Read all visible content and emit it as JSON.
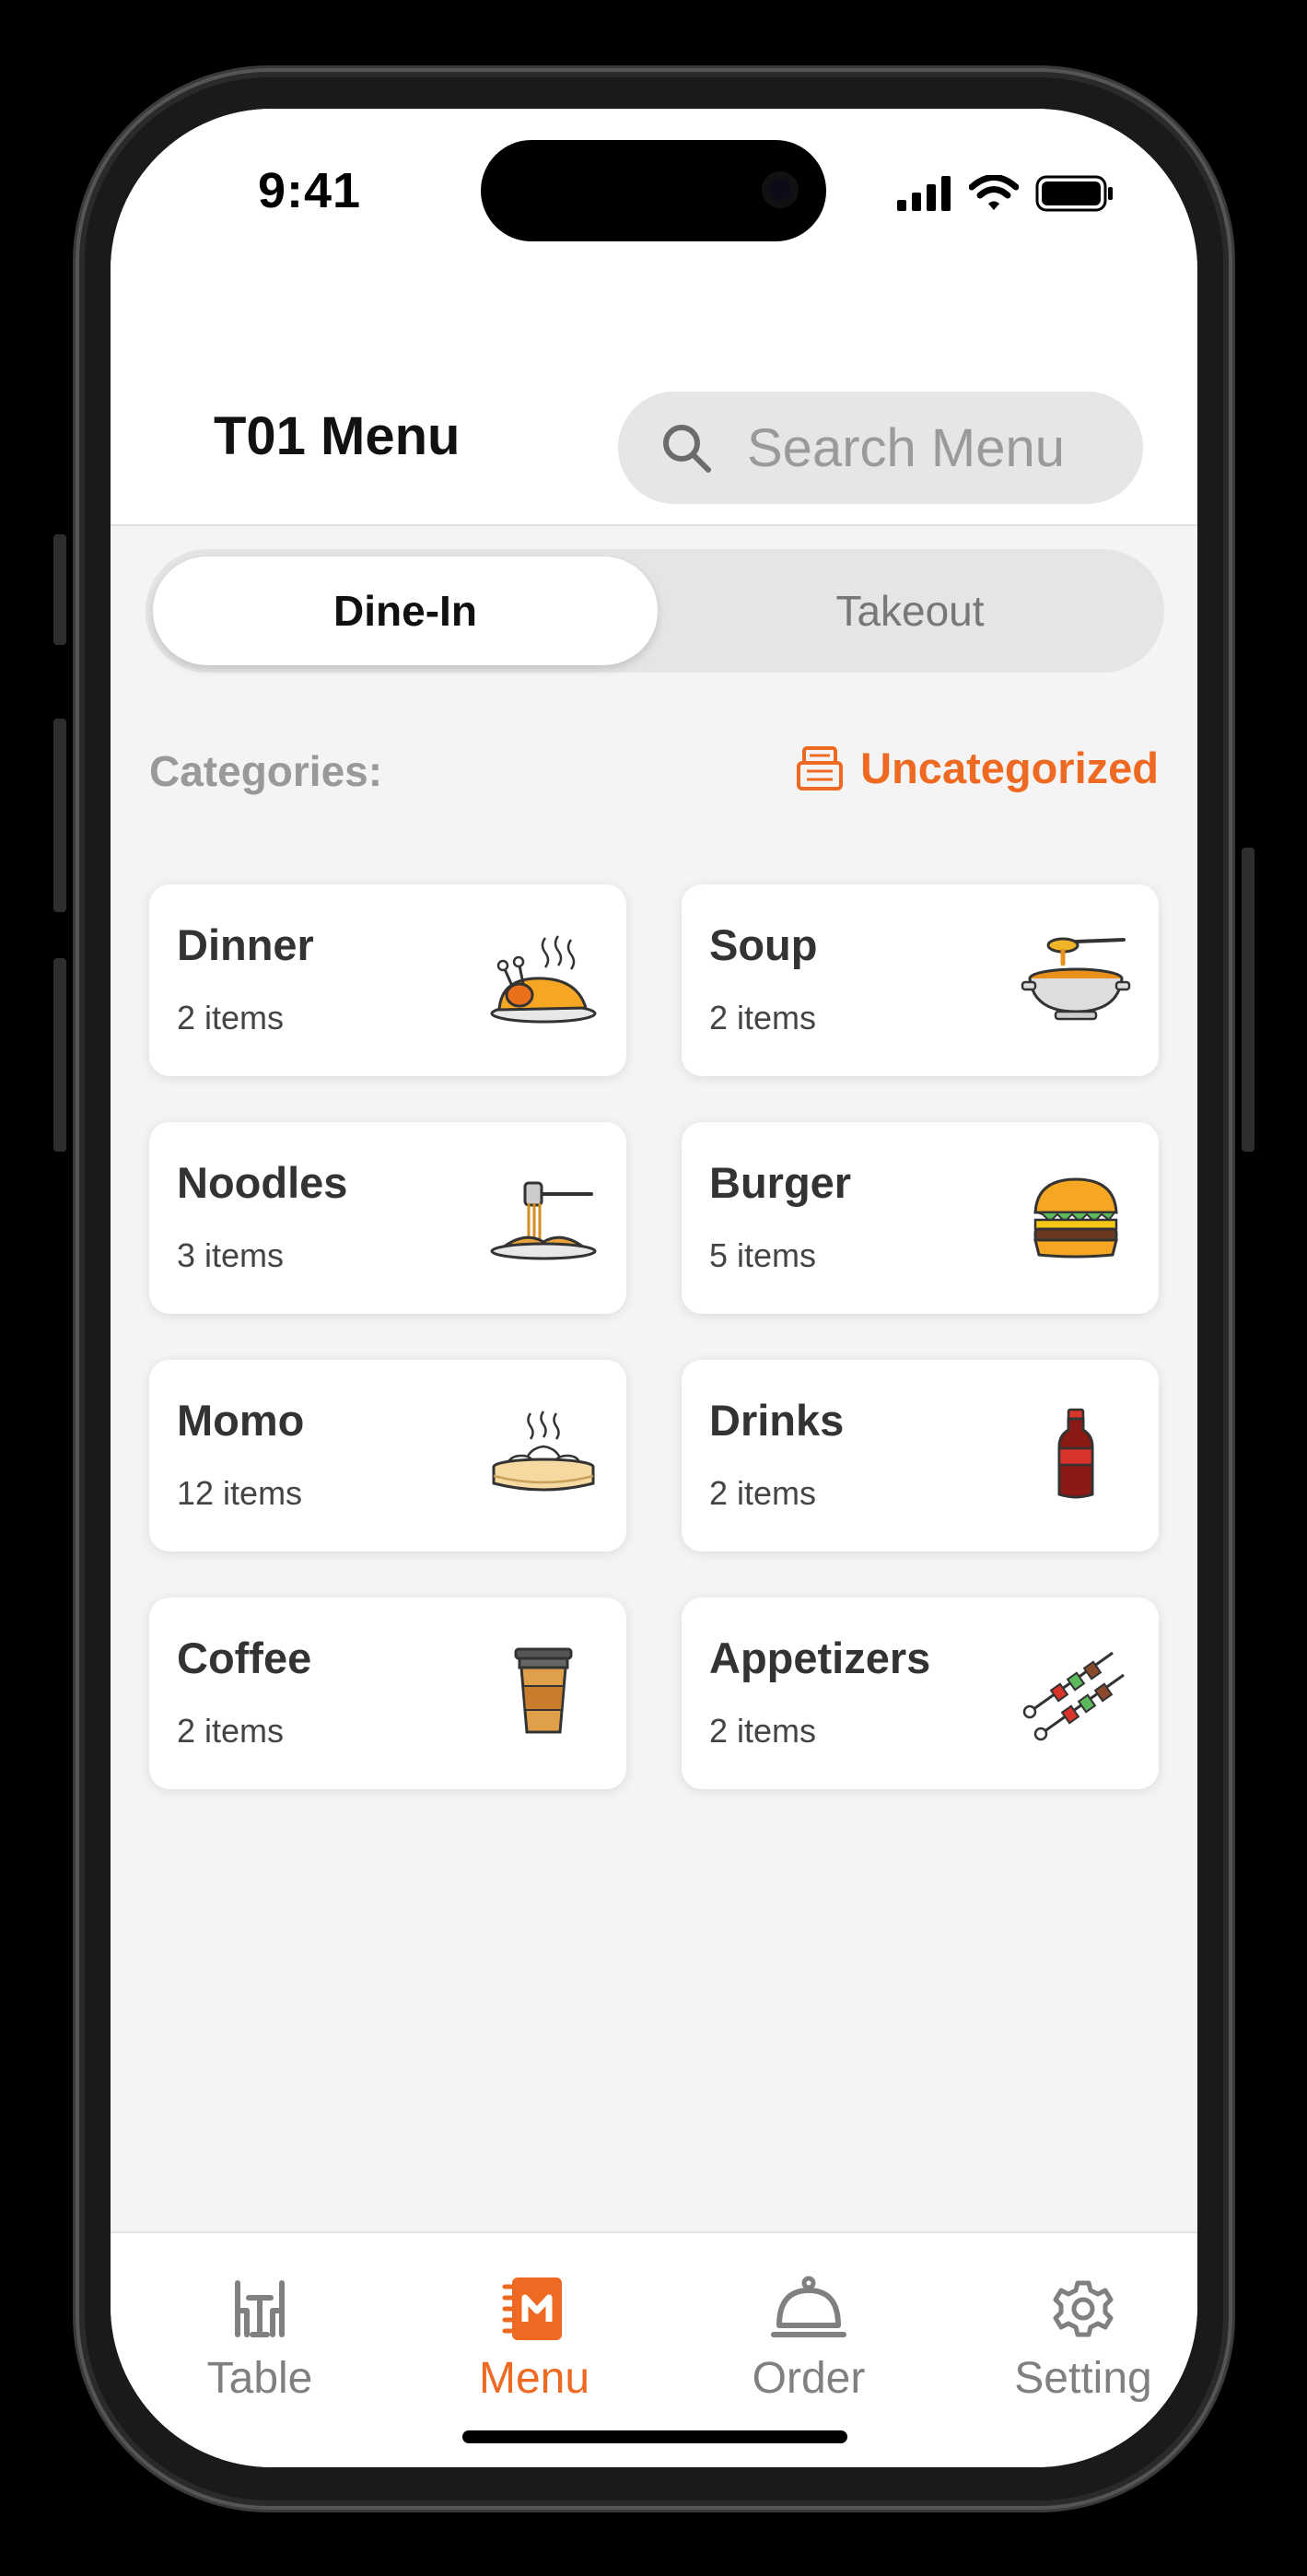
{
  "status_bar": {
    "time": "9:41"
  },
  "header": {
    "title": "T01 Menu",
    "search": {
      "placeholder": "Search Menu",
      "value": ""
    }
  },
  "order_type": {
    "options": [
      "Dine-In",
      "Takeout"
    ],
    "selected": "Dine-In"
  },
  "categories": {
    "label": "Categories:",
    "uncategorized_label": "Uncategorized",
    "accent_color": "#EE6A22",
    "items": [
      {
        "name": "Dinner",
        "count": "2 items",
        "icon": "roast-chicken-icon"
      },
      {
        "name": "Soup",
        "count": "2 items",
        "icon": "soup-bowl-icon"
      },
      {
        "name": "Noodles",
        "count": "3 items",
        "icon": "noodles-fork-icon"
      },
      {
        "name": "Burger",
        "count": "5 items",
        "icon": "burger-icon"
      },
      {
        "name": "Momo",
        "count": "12 items",
        "icon": "dumpling-steamer-icon"
      },
      {
        "name": "Drinks",
        "count": "2 items",
        "icon": "soda-bottle-icon"
      },
      {
        "name": "Coffee",
        "count": "2 items",
        "icon": "coffee-cup-icon"
      },
      {
        "name": "Appetizers",
        "count": "2 items",
        "icon": "skewers-icon"
      }
    ]
  },
  "tab_bar": {
    "tabs": [
      {
        "label": "Table",
        "icon": "table-chairs-icon"
      },
      {
        "label": "Menu",
        "icon": "menu-book-icon"
      },
      {
        "label": "Order",
        "icon": "cloche-icon"
      },
      {
        "label": "Setting",
        "icon": "gear-icon"
      }
    ],
    "active": "Menu"
  }
}
